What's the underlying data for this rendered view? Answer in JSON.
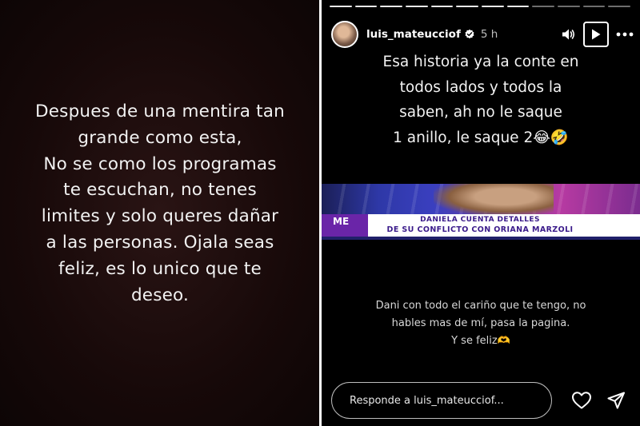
{
  "left_story": {
    "lines": [
      "Despues de una mentira tan",
      "grande como esta,",
      "No se como los programas",
      "te escuchan, no tenes",
      "limites y solo queres dañar",
      "a las personas. Ojala seas",
      "feliz, es lo unico que te",
      "deseo."
    ]
  },
  "right_story": {
    "progress_segments": 12,
    "current_segment": 8,
    "username": "luis_mateucciof",
    "time_ago": "5 h",
    "icons": {
      "verified": "verified-badge-icon",
      "volume": "volume-icon",
      "play": "play-icon",
      "more": "more-icon",
      "like": "heart-icon",
      "share": "send-icon"
    },
    "top_text_lines": [
      "Esa historia ya la conte en",
      "todos lados y todos la",
      "saben, ah no le saque",
      "1 anillo, le saque 2😂🤣"
    ],
    "tv_image": {
      "logo": "ME",
      "headline_line1": "DANIELA CUENTA DETALLES",
      "headline_line2": "DE SU CONFLICTO CON ORIANA MARZOLI"
    },
    "bottom_text_lines": [
      "Dani con todo el cariño que te tengo, no",
      "hables mas de mí, pasa la pagina.",
      "Y se feliz🫶"
    ],
    "reply_placeholder": "Responde a luis_mateucciof..."
  },
  "colors": {
    "left_background": "#170909",
    "right_background": "#000000",
    "text": "#f2f2f2"
  }
}
